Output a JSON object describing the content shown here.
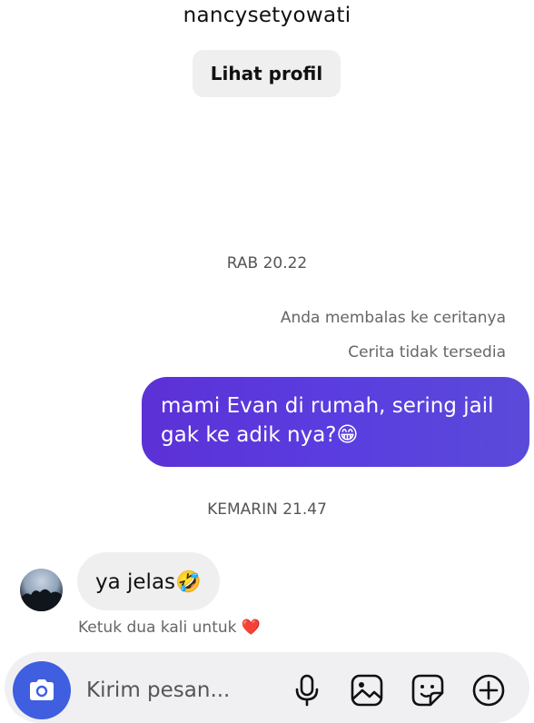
{
  "header": {
    "username": "nancysetyowati",
    "view_profile_label": "Lihat profil"
  },
  "messages": {
    "timestamp_1": "RAB 20.22",
    "story_reply_note": "Anda membalas ke ceritanya",
    "story_unavailable": "Cerita tidak tersedia",
    "outgoing_text": "mami Evan di rumah, sering jail gak ke adik nya?😁",
    "timestamp_2": "KEMARIN 21.47",
    "incoming_text": "ya jelas🤣",
    "double_tap_hint": "Ketuk dua kali untuk ❤️"
  },
  "composer": {
    "placeholder": "Kirim pesan...",
    "icons": [
      "camera-icon",
      "microphone-icon",
      "image-icon",
      "sticker-icon",
      "add-icon"
    ]
  },
  "colors": {
    "accent": "#3f5fe0",
    "outgoing_bubble": "#5a3de0",
    "incoming_bubble": "#efefef"
  }
}
